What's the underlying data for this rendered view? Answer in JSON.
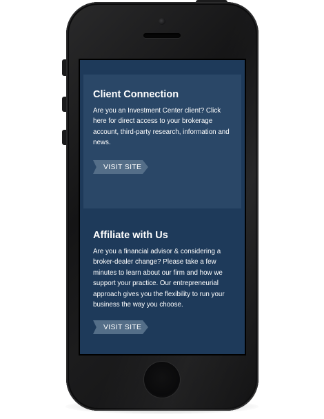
{
  "colors": {
    "screen_background": "#1e3a5a",
    "highlight_panel": "#2a4767",
    "button": "#546e88",
    "phone_body": "#141415"
  },
  "client_connection": {
    "title": "Client Connection",
    "description": "Are you an Investment Center client? Click here for direct access to your brokerage account, third-party research, information and news.",
    "button_label": "VISIT SITE"
  },
  "affiliate": {
    "title": "Affiliate with Us",
    "description": "Are you a financial advisor & considering a broker-dealer change? Please take a few minutes to learn about our firm and how we support your practice. Our entrepreneurial approach gives you the flexibility to run your business the way you choose.",
    "button_label": "VISIT SITE"
  }
}
